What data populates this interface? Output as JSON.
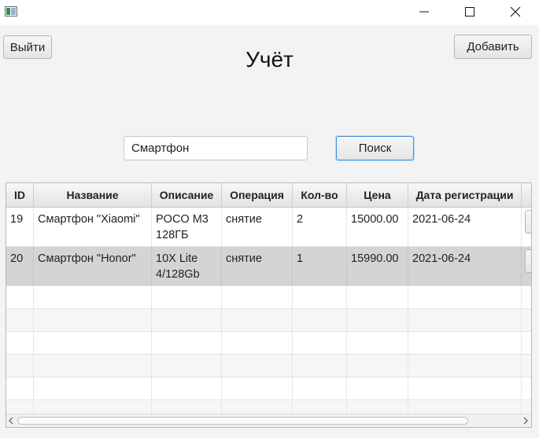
{
  "window": {
    "app_icon": "java-app-icon",
    "controls": [
      "minimize-icon",
      "maximize-icon",
      "close-icon"
    ]
  },
  "header": {
    "exit_label": "Выйти",
    "title": "Учёт",
    "add_label": "Добавить"
  },
  "search": {
    "value": "Смартфон",
    "button_label": "Поиск"
  },
  "table": {
    "columns": [
      "ID",
      "Название",
      "Описание",
      "Операция",
      "Кол-во",
      "Цена",
      "Дата регистрации"
    ],
    "rows": [
      {
        "id": "19",
        "name": "Смартфон \"Xiaomi\"",
        "description": "POCO M3\n128ГБ",
        "operation": "снятие",
        "qty": "2",
        "price": "15000.00",
        "date": "2021-06-24"
      },
      {
        "id": "20",
        "name": "Смартфон \"Honor\"",
        "description": "10X Lite\n4/128Gb",
        "operation": "снятие",
        "qty": "1",
        "price": "15990.00",
        "date": "2021-06-24"
      }
    ],
    "selected_row": 1
  },
  "colors": {
    "background": "#f3f3f3",
    "selected_row": "#d4d4d4",
    "focus_border": "#3f8fd6"
  }
}
